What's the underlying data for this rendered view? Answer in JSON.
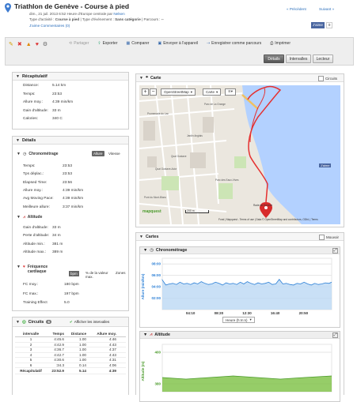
{
  "header": {
    "title": "Triathlon de Genève - Course à pied",
    "date": "dim., 21 juil. 2013 6:52 Heure d'Europe centrale par ",
    "author": "Nelsen",
    "type_label": "Type d'activité : ",
    "type_value": "Course à pied",
    "event_label": " | Type d'événement : ",
    "event_value": "Sans catégorie",
    "route_label": " | Parcours : ",
    "route_value": "--",
    "prev": "« Précédent",
    "next": "Suivant »",
    "like": "J'aime",
    "comments": "Commentaires (0)",
    "fb_like": "J'aime",
    "fb_count": "0"
  },
  "toolbar": {
    "share": "Partager",
    "export": "Exporter",
    "compare": "Comparer",
    "send": "Envoyer à l'appareil",
    "save_route": "Enregistrer comme parcours",
    "print": "Imprimer"
  },
  "tabs": [
    "Détails",
    "Intervalles",
    "Lecteur"
  ],
  "summary": {
    "title": "Récapitulatif",
    "rows": [
      [
        "Distance:",
        "5.14 km"
      ],
      [
        "Temps:",
        "23:53"
      ],
      [
        "Allure moy.:",
        "4:39 min/km"
      ],
      [
        "Gain d'altitude:",
        "33 m"
      ],
      [
        "Calories:",
        "340 C"
      ]
    ]
  },
  "details": {
    "title": "Détails",
    "timing": {
      "title": "Chronométrage",
      "tab_pace": "Allure",
      "tab_speed": "Vitesse",
      "rows": [
        [
          "Temps:",
          "23:53"
        ],
        [
          "Tps déplac.:",
          "23:53"
        ],
        [
          "Elapsed Time:",
          "23:56"
        ],
        [
          "Allure moy.:",
          "4:39 min/km"
        ],
        [
          "Avg Moving Pace:",
          "4:39 min/km"
        ],
        [
          "Meilleure allure:",
          "3:37 min/km"
        ]
      ]
    },
    "altitude": {
      "title": "Altitude",
      "rows": [
        [
          "Gain d'altitude:",
          "33 m"
        ],
        [
          "Perte d'altitude:",
          "34 m"
        ],
        [
          "Altitude min.:",
          "381 m"
        ],
        [
          "Altitude max.:",
          "389 m"
        ]
      ]
    },
    "hr": {
      "title": "Fréquence cardiaque",
      "tab_bpm": "bpm",
      "tab_pct": "% de la valeur max.",
      "zones": "Zones",
      "rows": [
        [
          "FC moy.:",
          "180 bpm"
        ],
        [
          "FC max.:",
          "197 bpm"
        ],
        [
          "Training Effect",
          "5.0"
        ]
      ]
    }
  },
  "laps": {
    "title": "Circuits",
    "count": "6",
    "show": "Afficher les intervalles",
    "cols": [
      "intervalle",
      "Temps",
      "Distance",
      "Allure moy."
    ],
    "rows": [
      [
        "1",
        "4:45.6",
        "1.00",
        "4:46"
      ],
      [
        "2",
        "4:42.9",
        "1.00",
        "4:43"
      ],
      [
        "3",
        "4:36.7",
        "1.00",
        "4:37"
      ],
      [
        "4",
        "4:42.7",
        "1.00",
        "4:43"
      ],
      [
        "5",
        "4:30.6",
        "1.00",
        "4:31"
      ],
      [
        "6",
        ":34.3",
        "0.14",
        "4:06"
      ]
    ],
    "summary": [
      "Récapitulatif",
      "23:52.9",
      "5.14",
      "4:39"
    ]
  },
  "map": {
    "title": "Carte",
    "circuits": "Circuits",
    "provider": "OpenStreetMap",
    "type": "Carte",
    "fb": "J'aime",
    "labels": [
      "Rade de Genève",
      "Quai Gustave-Ador",
      "Jardin Anglais",
      "Parc des Eaux-Vives",
      "Promenade du Lac",
      "Parc de La Grange",
      "Quai Gustave",
      "Pont du Mont-Blanc"
    ],
    "scale": "200 m",
    "attribution": "Fond | Mapquest - Terms of use | Data © OpenStreetMap and contributors, ODbL | Terms",
    "mapquest": "mapquest"
  },
  "charts": {
    "title": "Cartes",
    "move": "Mouvoir",
    "pace": {
      "title": "Chronométrage",
      "ylabel": "Allure (min/km)",
      "xlabel": "Heure (h:m:s)"
    },
    "alt": {
      "title": "Altitude",
      "ylabel": "Altitude (m)"
    }
  },
  "chart_data": [
    {
      "type": "area",
      "title": "Chronométrage",
      "ylabel": "Allure (min/km)",
      "xlabel": "Heure (h:m:s)",
      "yticks": [
        "02:00",
        "04:00",
        "06:00",
        "08:00"
      ],
      "xticks": [
        "04:10",
        "08:20",
        "12:30",
        "16:40",
        "20:50"
      ],
      "ylim": [
        0,
        9
      ],
      "xlim": [
        0,
        1433
      ],
      "x": [
        0,
        30,
        60,
        90,
        120,
        150,
        180,
        210,
        240,
        270,
        300,
        330,
        360,
        390,
        420,
        450,
        480,
        510,
        540,
        570,
        600,
        630,
        660,
        690,
        720,
        750,
        780,
        810,
        840,
        870,
        900,
        930,
        960,
        990,
        1020,
        1050,
        1080,
        1110,
        1140,
        1170,
        1200,
        1230,
        1260,
        1290,
        1320,
        1350,
        1380,
        1410,
        1433
      ],
      "y": [
        5.2,
        4.3,
        4.5,
        4.6,
        4.4,
        4.8,
        4.5,
        4.6,
        4.4,
        4.7,
        4.5,
        4.9,
        4.6,
        4.4,
        4.5,
        4.8,
        4.6,
        4.3,
        4.7,
        4.5,
        4.6,
        4.4,
        4.8,
        4.5,
        4.9,
        4.6,
        4.4,
        4.7,
        4.5,
        4.6,
        4.8,
        4.4,
        4.5,
        5.3,
        4.5,
        4.6,
        4.4,
        4.3,
        4.6,
        4.5,
        4.8,
        4.5,
        4.3,
        4.6,
        4.4,
        4.5,
        4.7,
        4.6,
        4.8
      ]
    },
    {
      "type": "area",
      "title": "Altitude",
      "ylabel": "Altitude (m)",
      "yticks": [
        "380",
        "400"
      ],
      "ylim": [
        375,
        405
      ],
      "x": [
        0,
        200,
        400,
        600,
        800,
        1000,
        1200,
        1433
      ],
      "y": [
        384,
        383,
        384,
        385,
        384,
        383,
        384,
        385
      ]
    }
  ],
  "colors": {
    "accent": "#2a6ebb",
    "pace_line": "#2b7fd6",
    "pace_fill": "#bcd8f4",
    "alt_fill": "#7cc142",
    "route": "#e53030"
  }
}
